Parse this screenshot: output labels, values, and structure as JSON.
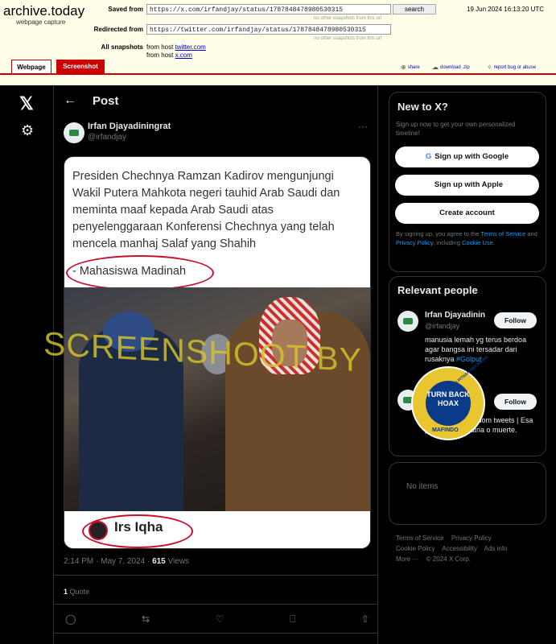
{
  "archive": {
    "brand": "archive.today",
    "brand_sub": "webpage capture",
    "saved_from_label": "Saved from",
    "saved_from_value": "https://x.com/irfandjay/status/1787848478980530315",
    "hint1": "no other snapshots from this url",
    "search_label": "search",
    "date": "19 Jun 2024 16:13:20 UTC",
    "redirected_label": "Redirected from",
    "redirected_value": "https://twitter.com/irfandjay/status/1787848478980530315",
    "hint2": "no other snapshots from this url",
    "all_snapshots_label": "All snapshots",
    "fromhost1_prefix": "from host",
    "fromhost1_link": "twitter.com",
    "fromhost2_prefix": "from host",
    "fromhost2_link": "x.com",
    "tool_share": "share",
    "tool_download": "download .zip",
    "tool_report": "report bug or abuse",
    "tab_webpage": "Webpage",
    "tab_screenshot": "Screenshot"
  },
  "nav": {
    "x_logo": "𝕏",
    "settings_icon": "⚙"
  },
  "post": {
    "back_icon": "←",
    "header_title": "Post",
    "author_name": "Irfan Djayadiningrat",
    "author_handle": "@irfandjay",
    "more_icon": "···",
    "image_quote": "Presiden Chechnya Ramzan Kadirov mengunjungi Wakil Putera Mahkota negeri tauhid Arab Saudi dan meminta maaf kepada Arab Saudi atas penyelenggaraan Konferensi Chechnya yang telah mencela manhaj Salaf yang Shahih",
    "image_source": "- Mahasiswa Madinah",
    "image_caption": "Irs Iqha",
    "timestamp": "2:14 PM · May 7, 2024 · ",
    "views_count": "615",
    "views_label": " Views",
    "quote_count": "1",
    "quote_label": " Quote",
    "actions": {
      "reply": "◯",
      "repost": "⇆",
      "like": "♡",
      "bookmark": "⎕",
      "share": "⇧"
    }
  },
  "watermark": {
    "text": "SCREENSHOOT BY",
    "badge_main": "TURN BACK HOAX",
    "badge_ring": "MASYARAKAT ANTI FITNAH INDONESIA",
    "badge_bottom": "MAFINDO"
  },
  "sidebar": {
    "new_title": "New to X?",
    "new_sub": "Sign up now to get your own personalized timeline!",
    "google_icon": "G",
    "google_label": "Sign up with Google",
    "apple_icon": "",
    "apple_label": "Sign up with Apple",
    "create_label": "Create account",
    "legal_prefix": "By signing up, you agree to the ",
    "legal_terms": "Terms of Service",
    "legal_and": " and ",
    "legal_privacy": "Privacy Policy",
    "legal_including": ", including ",
    "legal_cookie": "Cookie Use",
    "legal_end": ".",
    "relevant_title": "Relevant people",
    "people": [
      {
        "name": "Irfan Djayadinin",
        "handle": "@irfandjay",
        "follow": "Follow",
        "bio": "manusia lemah yg terus berdoa agar bangsa ini tersadar dari rusaknya",
        "bio_tag": "#Golput"
      },
      {
        "name": "",
        "handle": "",
        "follow": "Follow",
        "bio": "v me ~ I'm lost ndom tweets | Esa proclama es patria o muerte."
      }
    ],
    "no_items": "No items",
    "footer": [
      "Terms of Service",
      "Privacy Policy",
      "Cookie Policy",
      "Accessibility",
      "Ads info",
      "More ···",
      "© 2024 X Corp."
    ]
  }
}
